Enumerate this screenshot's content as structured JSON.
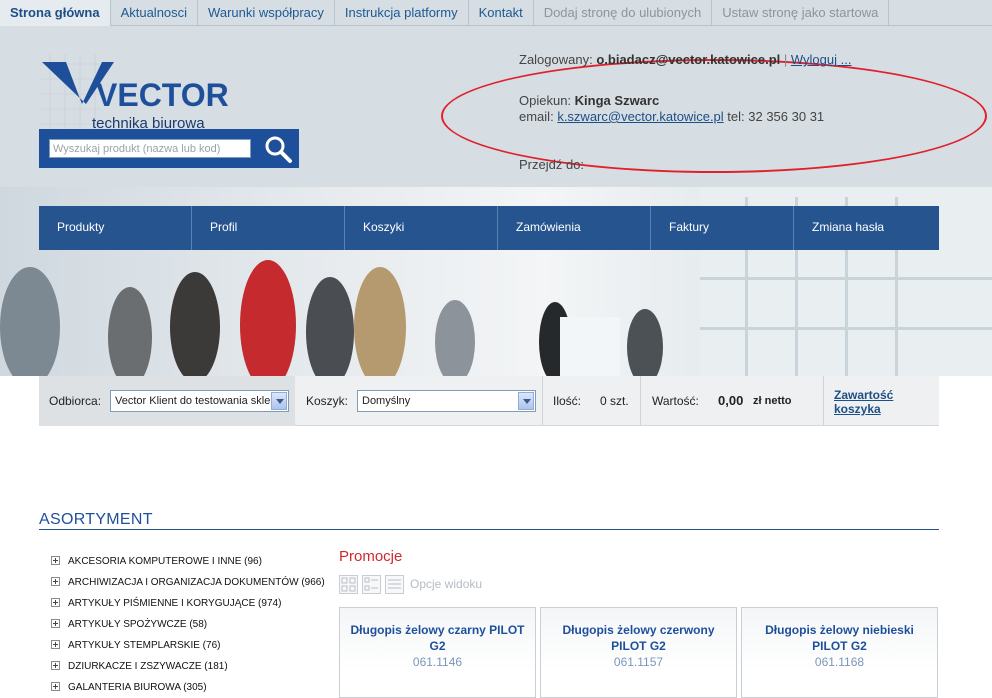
{
  "topnav": {
    "items": [
      "Strona główna",
      "Aktualnosci",
      "Warunki współpracy",
      "Instrukcja platformy",
      "Kontakt",
      "Dodaj stronę do ulubionych",
      "Ustaw stronę jako startowa"
    ]
  },
  "logo": {
    "brand": "VECTOR",
    "tagline": "technika biurowa"
  },
  "search": {
    "placeholder": "Wyszukaj produkt (nazwa lub kod)"
  },
  "user": {
    "logged_label": "Zalogowany:",
    "logged_email": "o.biadacz@vector.katowice.pl",
    "separator": "|",
    "logout": "Wyloguj ...",
    "guardian_label": "Opiekun:",
    "guardian_name": "Kinga Szwarc",
    "email_label": "email:",
    "guardian_email": "k.szwarc@vector.katowice.pl",
    "tel": "tel: 32 356 30 31",
    "goto_label": "Przejdź do:"
  },
  "mainmenu": [
    "Produkty",
    "Profil",
    "Koszyki",
    "Zamówienia",
    "Faktury",
    "Zmiana hasła"
  ],
  "cartbar": {
    "recipient_label": "Odbiorca:",
    "recipient_value": "Vector Klient do testowania sklepu",
    "cart_label": "Koszyk:",
    "cart_value": "Domyślny",
    "qty_label": "Ilość:",
    "qty_value": "0 szt.",
    "value_label": "Wartość:",
    "value_amount": "0,00",
    "value_unit": "zł netto",
    "contents_link": "Zawartość koszyka"
  },
  "assortment": {
    "title": "ASORTYMENT",
    "items": [
      "AKCESORIA KOMPUTEROWE I INNE (96)",
      "ARCHIWIZACJA I ORGANIZACJA DOKUMENTÓW (966)",
      "ARTYKUŁY PIŚMIENNE I KORYGUJĄCE (974)",
      "ARTYKUŁY SPOŻYWCZE (58)",
      "ARTYKUŁY STEMPLARSKIE (76)",
      "DZIURKACZE I ZSZYWACZE (181)",
      "GALANTERIA BIUROWA (305)"
    ]
  },
  "promo": {
    "title": "Promocje",
    "view_options": "Opcje widoku",
    "products": [
      {
        "name": "Długopis żelowy czarny PILOT G2",
        "code": "061.1146"
      },
      {
        "name": "Długopis żelowy czerwony PILOT G2",
        "code": "061.1157"
      },
      {
        "name": "Długopis żelowy niebieski PILOT G2",
        "code": "061.1168"
      }
    ]
  },
  "colors": {
    "brand_blue": "#1e4f9b",
    "menu_blue": "#26548f",
    "header_bg": "#d6dde3",
    "highlight_red": "#e0212b",
    "promo_red": "#d0282e"
  }
}
